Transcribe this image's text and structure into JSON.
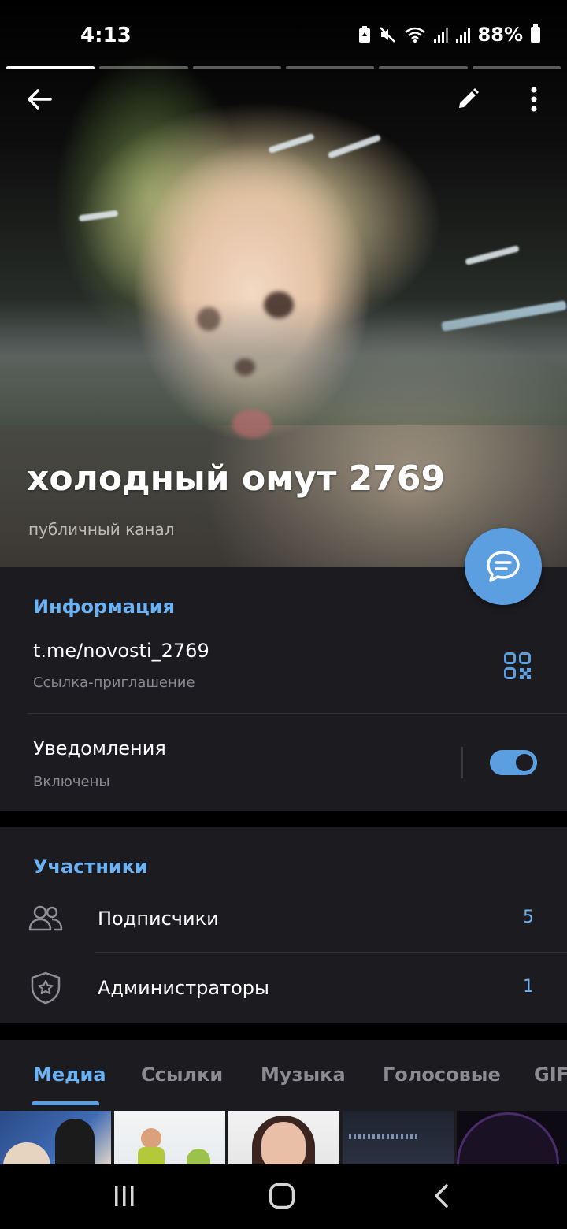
{
  "status_bar": {
    "time": "4:13",
    "battery": "88%"
  },
  "story": {
    "segments": 6,
    "active_segment": 1
  },
  "channel": {
    "title": "холодный омут 2769",
    "type": "публичный канал"
  },
  "info": {
    "title": "Информация",
    "link": "t.me/novosti_2769",
    "link_caption": "Ссылка-приглашение",
    "notifications_label": "Уведомления",
    "notifications_state": "Включены",
    "notifications_on": true
  },
  "members": {
    "title": "Участники",
    "rows": [
      {
        "label": "Подписчики",
        "count": "5",
        "icon": "people-icon"
      },
      {
        "label": "Администраторы",
        "count": "1",
        "icon": "shield-star-icon"
      }
    ]
  },
  "media_tabs": [
    "Медиа",
    "Ссылки",
    "Музыка",
    "Голосовые",
    "GIF"
  ],
  "media_active_tab": "Медиа",
  "colors": {
    "accent": "#5b9fe1",
    "accent_text": "#6cb3f5",
    "section_bg": "#1c1b20"
  }
}
